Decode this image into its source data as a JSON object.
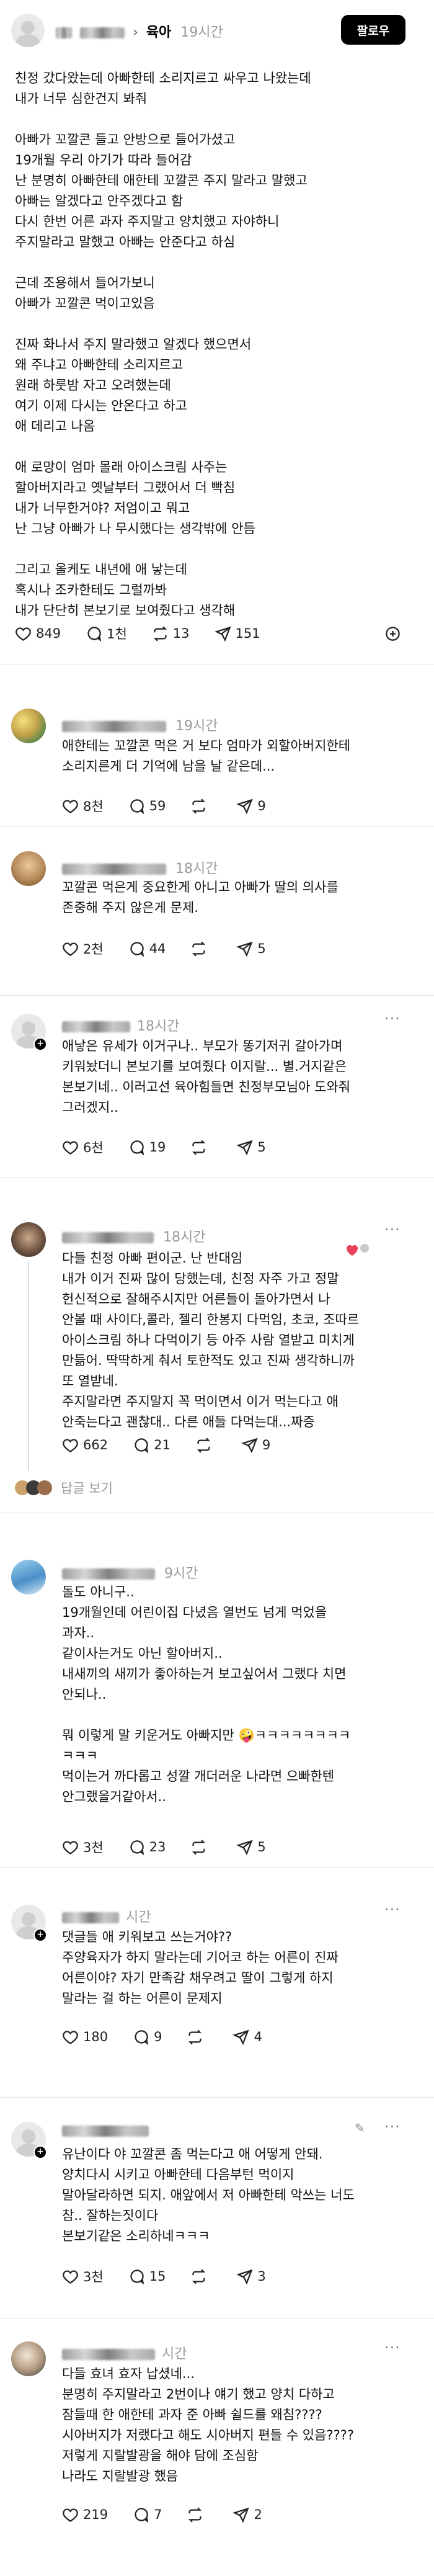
{
  "main_post": {
    "community": "육아",
    "time": "19시간",
    "follow_label": "팔로우",
    "body": "친정 갔다왔는데 아빠한테 소리지르고 싸우고 나왔는데\n내가 너무 심한건지 봐줘\n\n아빠가 꼬깔콘 들고 안방으로 들어가셨고\n19개월 우리 아기가 따라 들어감\n난 분명히 아빠한테 애한테 꼬깔콘 주지 말라고 말했고\n아빠는 알겠다고 안주겠다고 함\n다시 한번 어른 과자 주지말고 양치했고 자야하니\n주지말라고 말했고 아빠는 안준다고 하심\n\n근데 조용해서 들어가보니\n아빠가 꼬깔콘 먹이고있음\n\n진짜 화나서 주지 말라했고 알겠다 했으면서\n왜 주냐고 아빠한테 소리지르고\n원래 하룻밤 자고 오려했는데\n여기 이제 다시는 안온다고 하고\n애 데리고 나옴\n\n애 로망이 엄마 몰래 아이스크림 사주는\n할아버지라고 옛날부터 그랬어서 더 빡침\n내가 너무한거야? 저엄이고 뭐고\n난 그냥 아빠가 나 무시했다는 생각밖에 안듬\n\n그리고 올케도 내년에 애 낳는데\n혹시나 조카한테도 그럴까봐\n내가 단단히 본보기로 보여줬다고 생각해",
    "likes": "849",
    "comments": "1천",
    "reposts": "13",
    "shares": "151"
  },
  "replies": [
    {
      "time": "19시간",
      "body": "애한테는 꼬깔콘 먹은 거 보다 엄마가 외할아버지한테\n소리지른게 더 기억에 남을 날 같은데...",
      "likes": "8천",
      "comments": "59",
      "reposts": "",
      "shares": "9"
    },
    {
      "time": "18시간",
      "body": "꼬깔콘 먹은게 중요한게 아니고 아빠가 딸의 의사를\n존중해 주지 않은게 문제.",
      "likes": "2천",
      "comments": "44",
      "reposts": "",
      "shares": "5"
    },
    {
      "time": "18시간",
      "body": "애낳은 유세가 이거구나.. 부모가 똥기저귀 갈아가며\n키워놨더니 본보기를 보여줬다 이지랄... 별.거지같은\n본보기네.. 이러고선 육아힘들면 친정부모님아 도와줘\n그러겠지..",
      "likes": "6천",
      "comments": "19",
      "reposts": "",
      "shares": "5"
    },
    {
      "time": "18시간",
      "body": "다들 친정 아빠 편이군. 난 반대임\n내가 이거 진짜 많이 당했는데, 친정 자주 가고 정말\n헌신적으로 잘해주시지만 어른들이 돌아가면서 나\n안볼 때 사이다,콜라, 젤리 한봉지 다먹임, 초코, 조따르\n아이스크림 하나 다먹이기 등 아주 사람 열받고 미치게\n만듦어. 딱딱하게 춰서 토한적도 있고 진짜 생각하니까\n또 열받네.\n주지말라면 주지말지 꼭 먹이면서 이거 먹는다고 애\n안죽는다고 괜찮대.. 다른 애들 다먹는대...짜증",
      "likes": "662",
      "comments": "21",
      "reposts": "",
      "shares": "9"
    },
    {
      "more_replies": "답글 보기"
    },
    {
      "time": "9시간",
      "body": "돌도 아니구..\n19개월인데 어린이집 다녔음 열번도 넘게 먹었을\n과자..\n같이사는거도 아닌 할아버지..\n내새끼의 새끼가 좋아하는거 보고싶어서 그랬다 치면\n안되나..\n\n뭐 이렇게 말 키운거도 아빠지만 🤪ㅋㅋㅋㅋㅋㅋㅋㅋ\nㅋㅋㅋ\n먹이는거 까다롭고 성깔 개더러운 나라면 으빠한텐\n안그랬을거같아서..",
      "likes": "3천",
      "comments": "23",
      "reposts": "",
      "shares": "5"
    },
    {
      "time": "시간",
      "body": "댓글들 애 키워보고 쓰는거야??\n주양육자가 하지 말라는데 기어코 하는 어른이 진짜\n어른이야? 자기 만족감 채우려고 딸이 그렇게 하지\n말라는 걸 하는 어른이 문제지",
      "likes": "180",
      "comments": "9",
      "reposts": "",
      "shares": "4"
    },
    {
      "time": "",
      "body": "유난이다 야 꼬깔콘 좀 먹는다고 애 어떻게 안돼.\n양치다시 시키고 아빠한테 다음부턴 먹이지\n말아달라하면 되지. 애앞에서 저 아빠한테 악쓰는 너도\n참.. 잘하는짓이다\n본보기같은 소리하네ㅋㅋㅋ",
      "likes": "3천",
      "comments": "15",
      "reposts": "",
      "shares": "3"
    },
    {
      "time": "시간",
      "body": "다들 효녀 효자 납셨네...\n분명히 주지말라고 2번이나 얘기 했고 양치 다하고\n잠들때 한 애한테 과자 준 아빠 쉴드를 왜침????\n시아버지가 저랬다고 해도 시아버지 편들 수 있음????\n저렇게 지랄발광을 해야 담에 조심함\n나라도 지랄발광 했음",
      "likes": "219",
      "comments": "7",
      "reposts": "",
      "shares": "2"
    }
  ],
  "icons": {
    "like": "heart-icon",
    "comment": "comment-icon",
    "repost": "repost-icon",
    "share": "send-icon",
    "more": "more-icon"
  }
}
